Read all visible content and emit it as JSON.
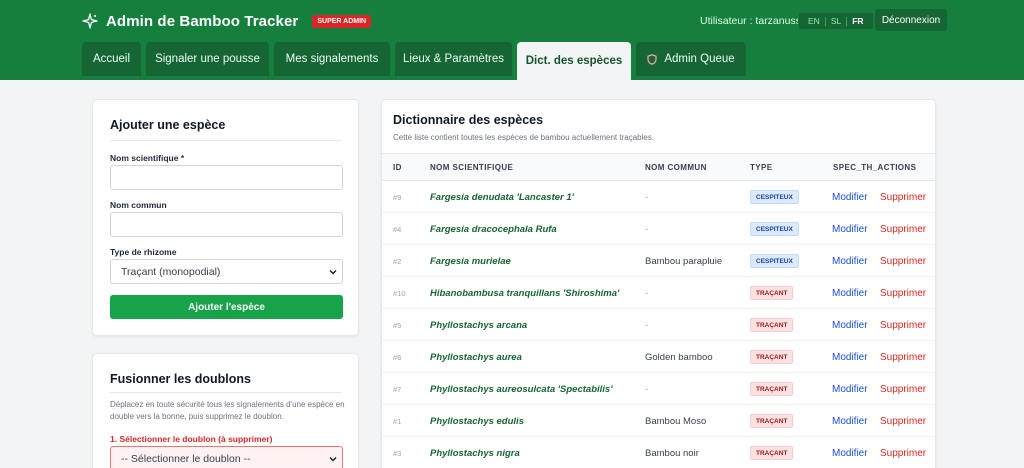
{
  "header": {
    "title": "Admin de Bamboo Tracker",
    "role_badge": "SUPER ADMIN",
    "user_label": "Utilisateur : tarzanuss",
    "languages": [
      "EN",
      "SL",
      "FR"
    ],
    "active_language": "FR",
    "logout_label": "Déconnexion",
    "brand_color": "#15803d"
  },
  "tabs": [
    {
      "label": "Accueil",
      "icon": null
    },
    {
      "label": "Signaler une pousse",
      "icon": null
    },
    {
      "label": "Mes signalements",
      "icon": null
    },
    {
      "label": "Lieux & Paramètres",
      "icon": null
    },
    {
      "label": "Dict. des espèces",
      "icon": null,
      "active": true
    },
    {
      "label": "Admin Queue",
      "icon": "shield-icon"
    }
  ],
  "add_species": {
    "title": "Ajouter une espèce",
    "scientific_label": "Nom scientifique *",
    "scientific_value": "",
    "common_label": "Nom commun",
    "common_value": "",
    "rhizome_label": "Type de rhizome",
    "rhizome_selected": "Traçant (monopodial)",
    "submit_label": "Ajouter l'espèce"
  },
  "merge": {
    "title": "Fusionner les doublons",
    "description": "Déplacez en toute sécurité tous les signalements d'une espèce en double vers la bonne, puis supprimez le doublon.",
    "step1_label": "1. Sélectionner le doublon (à supprimer)",
    "step1_selected": "-- Sélectionner le doublon --"
  },
  "dictionary": {
    "title": "Dictionnaire des espèces",
    "subtitle": "Cette liste contient toutes les espèces de bambou actuellement traçables.",
    "columns": [
      "ID",
      "NOM SCIENTIFIQUE",
      "NOM COMMUN",
      "TYPE",
      "SPEC_TH_ACTIONS"
    ],
    "edit_label": "Modifier",
    "delete_label": "Supprimer",
    "rows": [
      {
        "id": "#9",
        "scientific": "Fargesia denudata 'Lancaster 1'",
        "common": "-",
        "type": "CESPITEUX",
        "type_color": "blue"
      },
      {
        "id": "#4",
        "scientific": "Fargesia dracocephala Rufa",
        "common": "-",
        "type": "CESPITEUX",
        "type_color": "blue"
      },
      {
        "id": "#2",
        "scientific": "Fargesia murielae",
        "common": "Bambou parapluie",
        "type": "CESPITEUX",
        "type_color": "blue"
      },
      {
        "id": "#10",
        "scientific": "Hibanobambusa tranquillans 'Shiroshima'",
        "common": "-",
        "type": "TRAÇANT",
        "type_color": "red"
      },
      {
        "id": "#5",
        "scientific": "Phyllostachys arcana",
        "common": "-",
        "type": "TRAÇANT",
        "type_color": "red"
      },
      {
        "id": "#6",
        "scientific": "Phyllostachys aurea",
        "common": "Golden bamboo",
        "type": "TRAÇANT",
        "type_color": "red"
      },
      {
        "id": "#7",
        "scientific": "Phyllostachys aureosulcata 'Spectabilis'",
        "common": "-",
        "type": "TRAÇANT",
        "type_color": "red"
      },
      {
        "id": "#1",
        "scientific": "Phyllostachys edulis",
        "common": "Bambou Moso",
        "type": "TRAÇANT",
        "type_color": "red"
      },
      {
        "id": "#3",
        "scientific": "Phyllostachys nigra",
        "common": "Bambou noir",
        "type": "TRAÇANT",
        "type_color": "red"
      }
    ]
  }
}
